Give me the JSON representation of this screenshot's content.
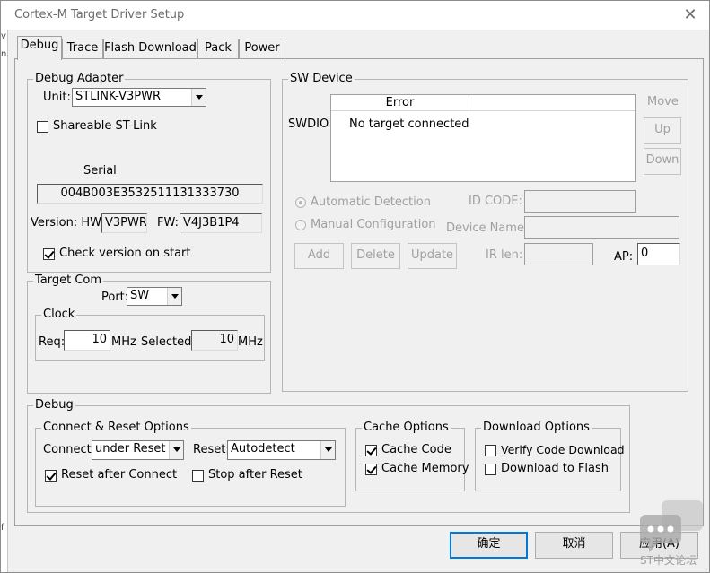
{
  "window": {
    "title": "Cortex-M Target Driver Setup",
    "close_glyph": "✕"
  },
  "background": {
    "marks": [
      "v",
      "n.",
      "f"
    ]
  },
  "tabs": [
    {
      "label": "Debug",
      "active": true
    },
    {
      "label": "Trace"
    },
    {
      "label": "Flash Download"
    },
    {
      "label": "Pack"
    },
    {
      "label": "Power"
    }
  ],
  "debug_adapter": {
    "label": "Debug Adapter",
    "unit_label": "Unit:",
    "unit_value": "STLINK-V3PWR",
    "shareable_label": "Shareable ST-Link",
    "shareable_checked": false,
    "serial_label": "Serial",
    "serial_value": "004B003E3532511131333730",
    "version_label": "Version: HW:",
    "hw_value": "V3PWR",
    "fw_label": "FW:",
    "fw_value": "V4J3B1P4",
    "check_version_label": "Check version on start",
    "check_version_checked": true
  },
  "target_com": {
    "label": "Target Com",
    "port_label": "Port:",
    "port_value": "SW",
    "clock_label": "Clock",
    "req_label": "Req:",
    "req_value": "10",
    "mhz1": "MHz",
    "selected_label": "Selected:",
    "selected_value": "10",
    "mhz2": "MHz"
  },
  "sw_device": {
    "label": "SW Device",
    "swdio_label": "SWDIO",
    "col_error": "Error",
    "row_text": "No target connected",
    "move_label": "Move",
    "up_label": "Up",
    "down_label": "Down",
    "auto_detect_label": "Automatic Detection",
    "manual_config_label": "Manual Configuration",
    "id_code_label": "ID CODE:",
    "device_name_label": "Device Name:",
    "add_label": "Add",
    "delete_label": "Delete",
    "update_label": "Update",
    "ir_len_label": "IR len:",
    "ap_label": "AP:",
    "ap_value": "0"
  },
  "debug": {
    "label": "Debug",
    "connect_reset": {
      "label": "Connect & Reset Options",
      "connect_label": "Connect:",
      "connect_value": "under Reset",
      "reset_label": "Reset:",
      "reset_value": "Autodetect",
      "reset_after_connect_label": "Reset after Connect",
      "reset_after_connect_checked": true,
      "stop_after_reset_label": "Stop after Reset",
      "stop_after_reset_checked": false
    },
    "cache": {
      "label": "Cache Options",
      "cache_code_label": "Cache Code",
      "cache_code_checked": true,
      "cache_memory_label": "Cache Memory",
      "cache_memory_checked": true
    },
    "download": {
      "label": "Download Options",
      "verify_label": "Verify Code Download",
      "verify_checked": false,
      "download_flash_label": "Download to Flash",
      "download_flash_checked": false
    }
  },
  "buttons": {
    "ok": "确定",
    "cancel": "取消",
    "apply": "应用(A)"
  },
  "watermark": {
    "text": "ST中文论坛"
  }
}
